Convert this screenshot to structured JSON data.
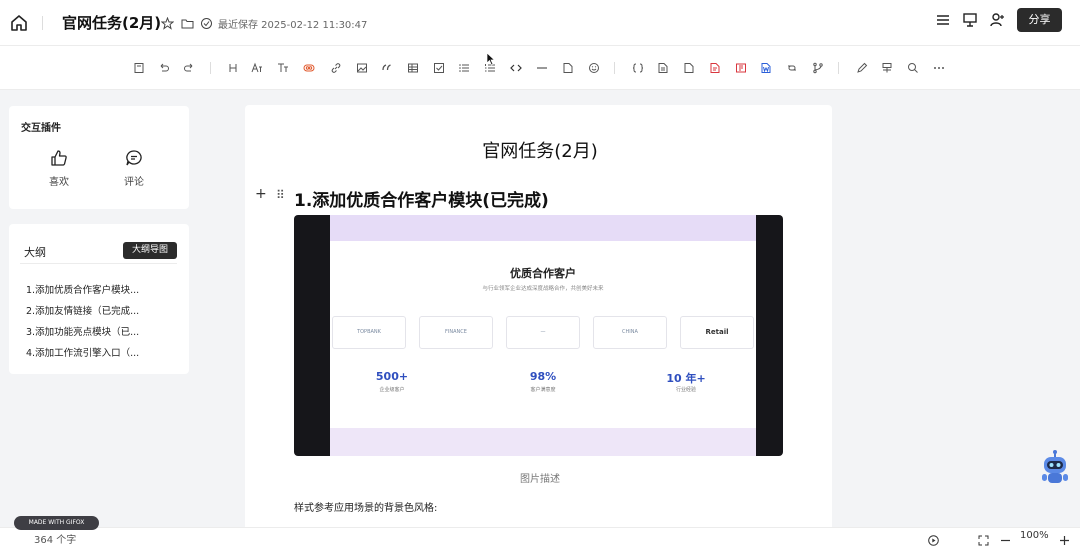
{
  "header": {
    "title": "官网任务(2月)",
    "saved_text": "最近保存 2025-02-12 11:30:47",
    "share_label": "分享"
  },
  "toolbar": {
    "items": [
      "save-icon",
      "undo-icon",
      "redo-icon",
      "heading-icon",
      "font-size-icon",
      "text-style-icon",
      "highlight-icon",
      "link-icon",
      "image-icon",
      "quote-icon",
      "table-icon",
      "checklist-icon",
      "bullet-list-icon",
      "ordered-list-icon",
      "code-icon",
      "divider-icon",
      "file-icon",
      "emoji-icon",
      "formula-icon",
      "doc-icon",
      "doc-blank-icon",
      "pdf-icon",
      "ppt-icon",
      "word-icon",
      "embed-icon",
      "branch-icon",
      "pen-icon",
      "format-painter-icon",
      "search-icon",
      "more-icon"
    ]
  },
  "sidebar": {
    "interaction": {
      "title": "交互插件",
      "like_label": "喜欢",
      "comment_label": "评论"
    },
    "outline": {
      "tab_label": "大纲",
      "mindmap_label": "大纲导图",
      "items": [
        "1.添加优质合作客户模块...",
        "2.添加友情链接（已完成...",
        "3.添加功能亮点模块（已...",
        "4.添加工作流引擎入口（..."
      ]
    }
  },
  "document": {
    "title": "官网任务(2月)",
    "section_heading": "1.添加优质合作客户模块(已完成)",
    "image_caption": "图片描述",
    "paragraph": "样式参考应用场景的背景色风格:",
    "embedded_image": {
      "title": "优质合作客户",
      "subtitle": "与行业领军企业达成深度战略合作，共创美好未来",
      "logos": [
        "TOPBANK",
        "FINANCE",
        "—",
        "CHINA",
        "Retail"
      ],
      "stats": [
        {
          "value": "500+",
          "label": "企业级客户"
        },
        {
          "value": "98%",
          "label": "客户满意度"
        },
        {
          "value": "10 年+",
          "label": "行业经验"
        }
      ]
    }
  },
  "footer": {
    "word_count": "364 个字",
    "zoom": "100%",
    "gifox_label": "MADE WITH GIFOX"
  },
  "colors": {
    "accent_dark": "#2b2b2b",
    "stat_blue": "#2f4fbf",
    "image_band": "#e6dcf7"
  }
}
